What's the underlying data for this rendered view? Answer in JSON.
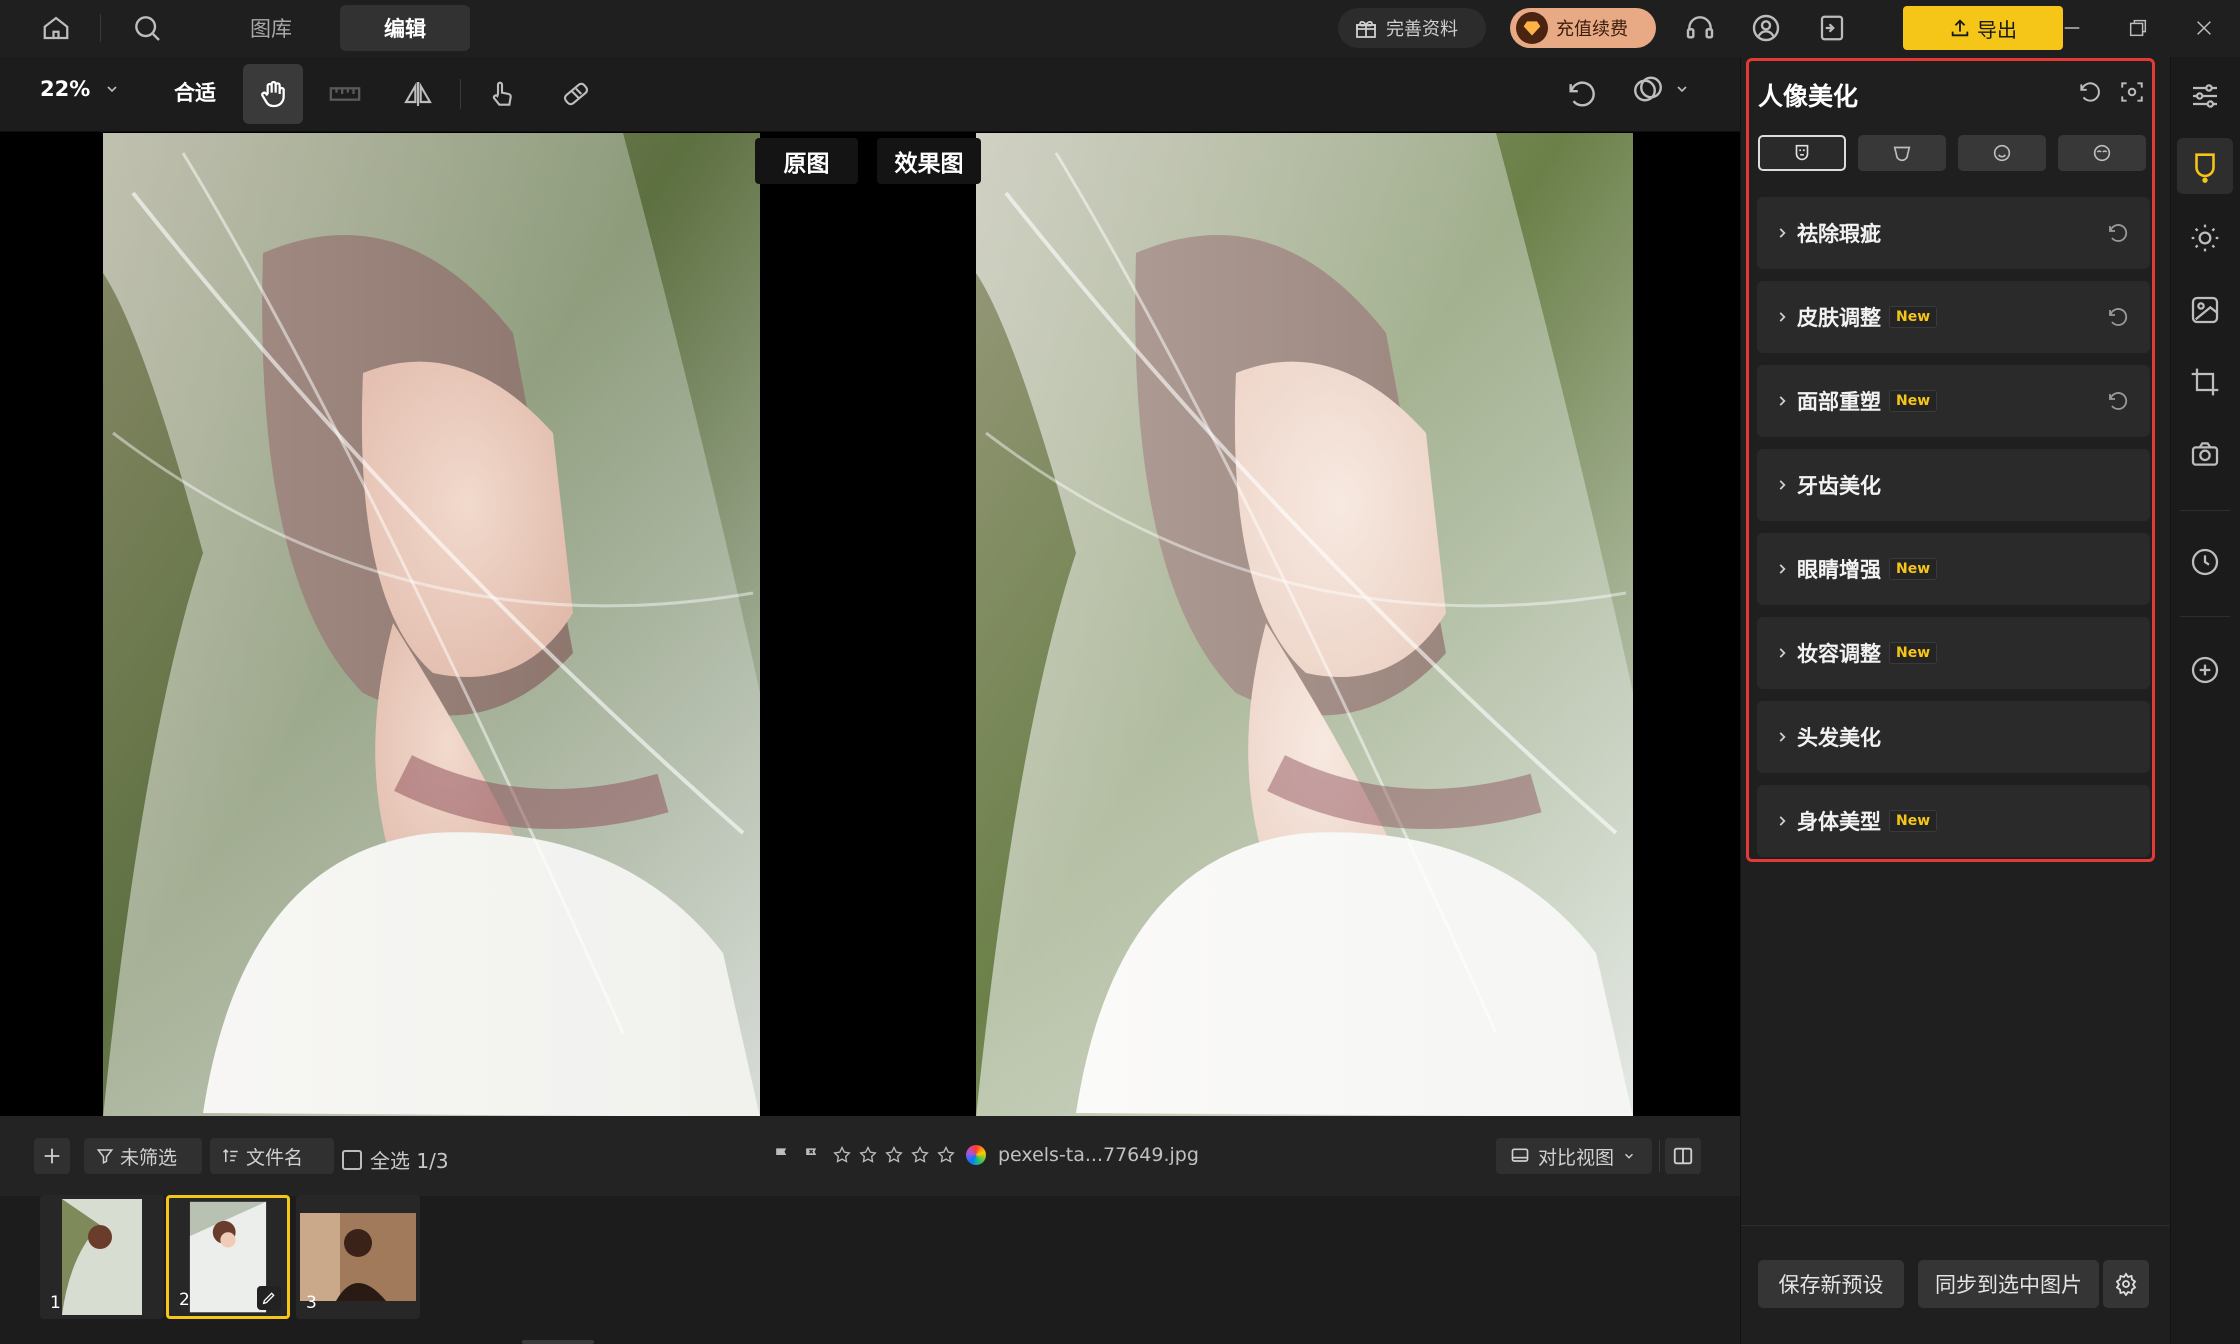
{
  "top_bar": {
    "tabs": [
      {
        "label": "图库"
      },
      {
        "label": "编辑",
        "active": true
      }
    ],
    "complete_profile_label": "完善资料",
    "recharge_label": "充值续费",
    "export_label": "导出"
  },
  "toolbar": {
    "zoom": "22%",
    "fit_label": "合适"
  },
  "canvas": {
    "original_label": "原图",
    "effect_label": "效果图"
  },
  "filmbar": {
    "filter_label": "未筛选",
    "sort_label": "文件名",
    "select_all_label": "全选 1/3",
    "filename": "pexels-ta...77649.jpg",
    "stars": 0,
    "view_mode_label": "对比视图"
  },
  "thumbnails": [
    {
      "number": "1"
    },
    {
      "number": "2",
      "selected": true
    },
    {
      "number": "3"
    }
  ],
  "panel": {
    "title": "人像美化",
    "new_tag": "New",
    "items": [
      {
        "label": "祛除瑕疵",
        "new": false,
        "reset": true
      },
      {
        "label": "皮肤调整",
        "new": true,
        "reset": true
      },
      {
        "label": "面部重塑",
        "new": true,
        "reset": true
      },
      {
        "label": "牙齿美化",
        "new": false,
        "reset": false
      },
      {
        "label": "眼睛增强",
        "new": true,
        "reset": false
      },
      {
        "label": "妆容调整",
        "new": true,
        "reset": false
      },
      {
        "label": "头发美化",
        "new": false,
        "reset": false
      },
      {
        "label": "身体美型",
        "new": true,
        "reset": false
      }
    ],
    "save_preset_label": "保存新预设",
    "sync_label": "同步到选中图片"
  },
  "colors": {
    "accent_yellow": "#f5c518",
    "highlight_red": "#e53935",
    "panel_bg": "#1f1f1f",
    "row_bg": "#2a2a2a"
  }
}
